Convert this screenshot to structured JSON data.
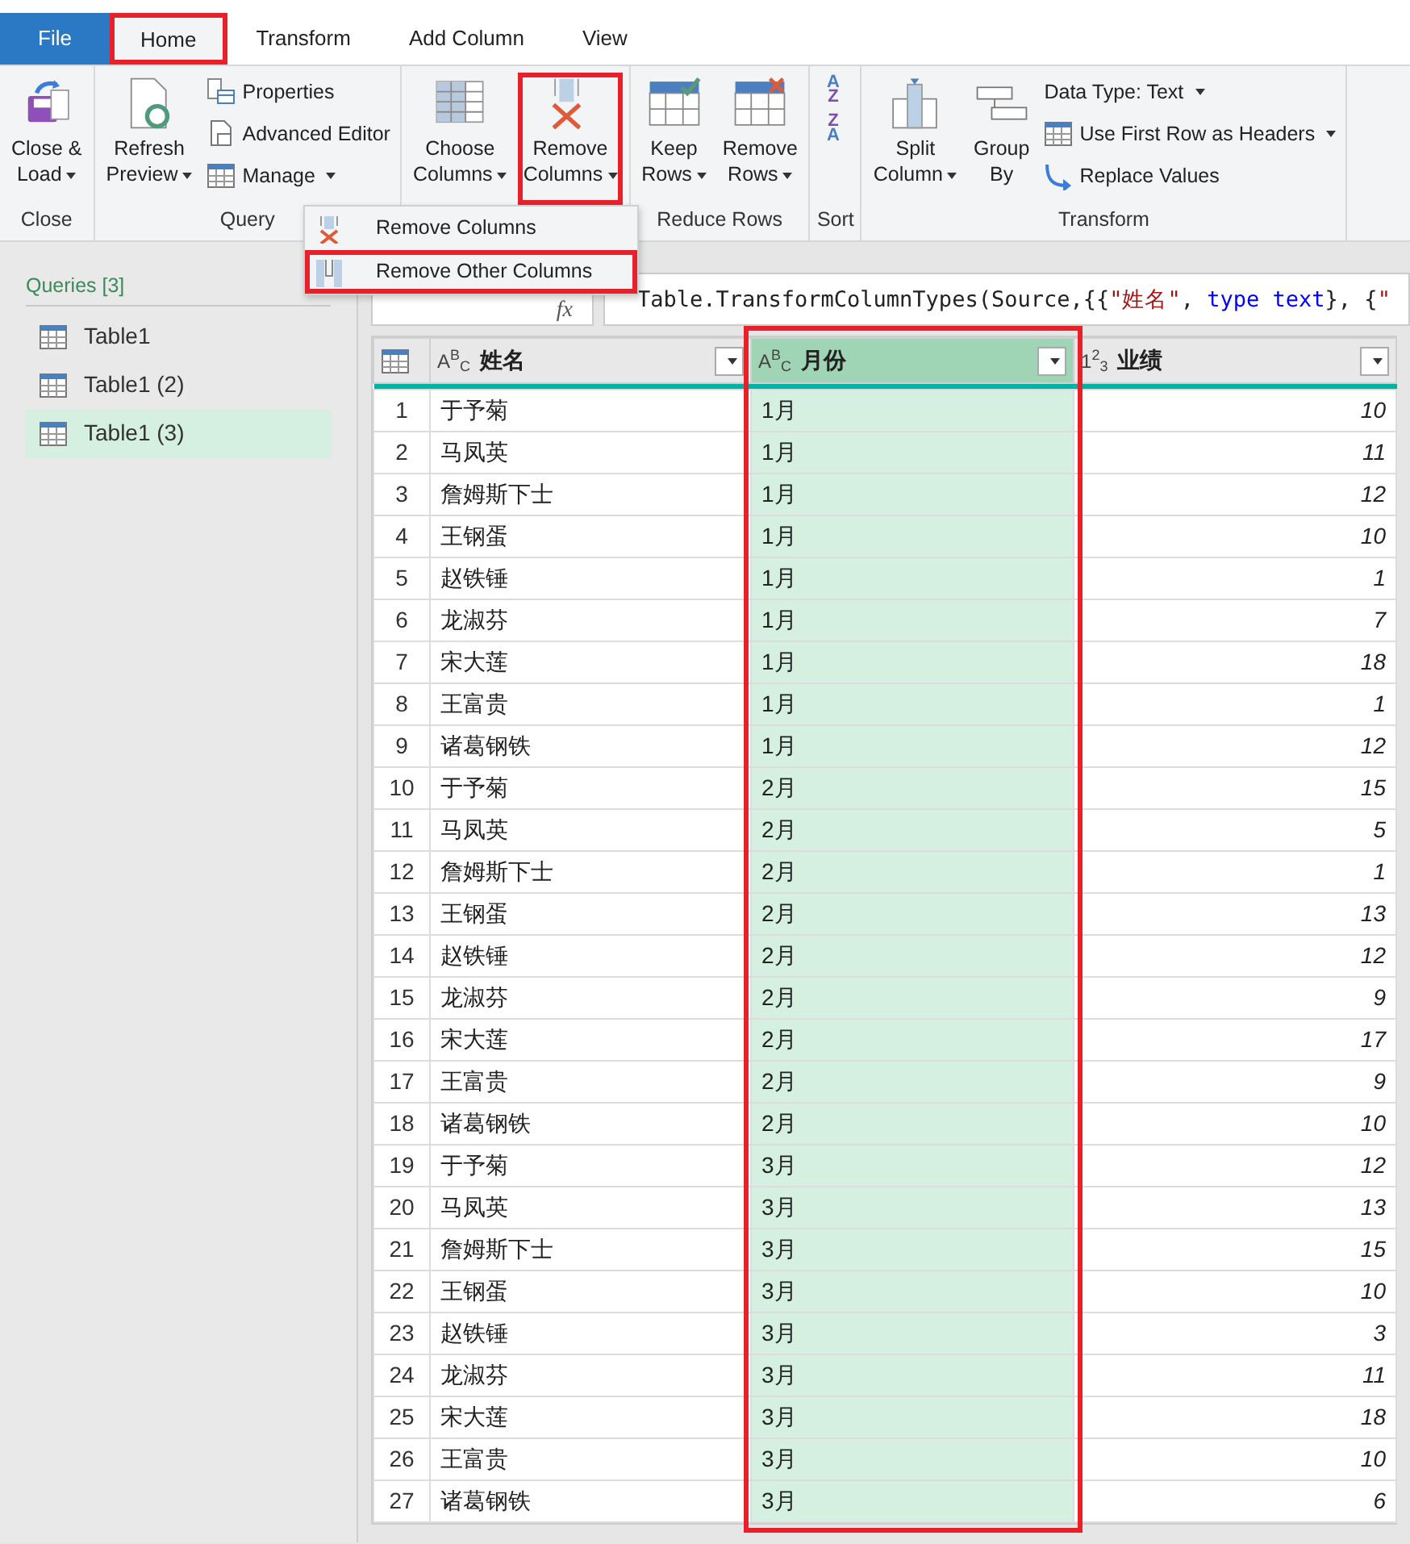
{
  "tabs": [
    {
      "label": "File",
      "kind": "file",
      "selected": false,
      "highlighted": false
    },
    {
      "label": "Home",
      "kind": "tab",
      "selected": true,
      "highlighted": true
    },
    {
      "label": "Transform",
      "kind": "tab",
      "selected": false,
      "highlighted": false
    },
    {
      "label": "Add Column",
      "kind": "tab",
      "selected": false,
      "highlighted": false
    },
    {
      "label": "View",
      "kind": "tab",
      "selected": false,
      "highlighted": false
    }
  ],
  "ribbon": {
    "groups": [
      {
        "label": "Close",
        "items": [
          {
            "kind": "large",
            "lines": [
              "Close &",
              "Load"
            ],
            "caret": true,
            "highlighted": false
          }
        ]
      },
      {
        "label": "Query",
        "items": [
          {
            "kind": "large",
            "lines": [
              "Refresh",
              "Preview"
            ],
            "caret": true,
            "highlighted": false
          },
          {
            "kind": "stack",
            "entries": [
              {
                "label": "Properties",
                "caret": false
              },
              {
                "label": "Advanced Editor",
                "caret": false
              },
              {
                "label": "Manage",
                "caret": true
              }
            ]
          }
        ]
      },
      {
        "items": [
          {
            "kind": "large",
            "lines": [
              "Choose",
              "Columns"
            ],
            "caret": true,
            "highlighted": false
          },
          {
            "kind": "large",
            "lines": [
              "Remove",
              "Columns"
            ],
            "caret": true,
            "highlighted": true
          }
        ]
      },
      {
        "label": "Reduce Rows",
        "items": [
          {
            "kind": "large",
            "lines": [
              "Keep",
              "Rows"
            ],
            "caret": true,
            "highlighted": false
          },
          {
            "kind": "large",
            "lines": [
              "Remove",
              "Rows"
            ],
            "caret": true,
            "highlighted": false
          }
        ]
      },
      {
        "label": "Sort",
        "items": [
          {
            "kind": "sort",
            "entries": [
              {
                "glyphs": [
                  "A",
                  "Z"
                ]
              },
              {
                "glyphs": [
                  "Z",
                  "A"
                ]
              }
            ]
          }
        ]
      },
      {
        "label": "Transform",
        "items": [
          {
            "kind": "large",
            "lines": [
              "Split",
              "Column"
            ],
            "caret": true,
            "highlighted": false
          },
          {
            "kind": "large",
            "lines": [
              "Group",
              "By"
            ],
            "caret": false,
            "highlighted": false
          },
          {
            "kind": "stack",
            "entries": [
              {
                "label": "Data Type: Text",
                "caret": true
              },
              {
                "label": "Use First Row as Headers",
                "caret": true
              },
              {
                "label": "Replace Values",
                "caret": false
              }
            ]
          }
        ]
      }
    ]
  },
  "menu": {
    "items": [
      {
        "label": "Remove Columns",
        "highlighted": false
      },
      {
        "label": "Remove Other Columns",
        "highlighted": true
      }
    ]
  },
  "queries": {
    "heading": "Queries [3]",
    "items": [
      {
        "label": "Table1",
        "selected": false
      },
      {
        "label": "Table1 (2)",
        "selected": false
      },
      {
        "label": "Table1 (3)",
        "selected": true
      }
    ]
  },
  "formula_bar": {
    "fx": "fx",
    "tokens": [
      {
        "text": "Table.TransformColumnTypes(Source,{{",
        "kind": "plain"
      },
      {
        "text": "\"姓名\"",
        "kind": "string"
      },
      {
        "text": ", ",
        "kind": "plain"
      },
      {
        "text": "type text",
        "kind": "keyword"
      },
      {
        "text": "}, {",
        "kind": "plain"
      },
      {
        "text": "\"",
        "kind": "string"
      }
    ]
  },
  "table": {
    "columns": [
      {
        "type": "A$^{B}$$_{C}$",
        "name": "姓名",
        "kind": "text",
        "selected": false,
        "highlighted": false
      },
      {
        "type": "A$^{B}$$_{C}$",
        "name": "月份",
        "kind": "text",
        "selected": true,
        "highlighted": true
      },
      {
        "type": "1$^{2}$$_{3}$",
        "name": "业绩",
        "kind": "number",
        "selected": false,
        "highlighted": false
      }
    ],
    "rows": [
      {
        "number": "1",
        "cells": [
          "于予菊",
          "1月",
          "10"
        ]
      },
      {
        "number": "2",
        "cells": [
          "马凤英",
          "1月",
          "11"
        ]
      },
      {
        "number": "3",
        "cells": [
          "詹姆斯下士",
          "1月",
          "12"
        ]
      },
      {
        "number": "4",
        "cells": [
          "王钢蛋",
          "1月",
          "10"
        ]
      },
      {
        "number": "5",
        "cells": [
          "赵铁锤",
          "1月",
          "1"
        ]
      },
      {
        "number": "6",
        "cells": [
          "龙淑芬",
          "1月",
          "7"
        ]
      },
      {
        "number": "7",
        "cells": [
          "宋大莲",
          "1月",
          "18"
        ]
      },
      {
        "number": "8",
        "cells": [
          "王富贵",
          "1月",
          "1"
        ]
      },
      {
        "number": "9",
        "cells": [
          "诸葛钢铁",
          "1月",
          "12"
        ]
      },
      {
        "number": "10",
        "cells": [
          "于予菊",
          "2月",
          "15"
        ]
      },
      {
        "number": "11",
        "cells": [
          "马凤英",
          "2月",
          "5"
        ]
      },
      {
        "number": "12",
        "cells": [
          "詹姆斯下士",
          "2月",
          "1"
        ]
      },
      {
        "number": "13",
        "cells": [
          "王钢蛋",
          "2月",
          "13"
        ]
      },
      {
        "number": "14",
        "cells": [
          "赵铁锤",
          "2月",
          "12"
        ]
      },
      {
        "number": "15",
        "cells": [
          "龙淑芬",
          "2月",
          "9"
        ]
      },
      {
        "number": "16",
        "cells": [
          "宋大莲",
          "2月",
          "17"
        ]
      },
      {
        "number": "17",
        "cells": [
          "王富贵",
          "2月",
          "9"
        ]
      },
      {
        "number": "18",
        "cells": [
          "诸葛钢铁",
          "2月",
          "10"
        ]
      },
      {
        "number": "19",
        "cells": [
          "于予菊",
          "3月",
          "12"
        ]
      },
      {
        "number": "20",
        "cells": [
          "马凤英",
          "3月",
          "13"
        ]
      },
      {
        "number": "21",
        "cells": [
          "詹姆斯下士",
          "3月",
          "15"
        ]
      },
      {
        "number": "22",
        "cells": [
          "王钢蛋",
          "3月",
          "10"
        ]
      },
      {
        "number": "23",
        "cells": [
          "赵铁锤",
          "3月",
          "3"
        ]
      },
      {
        "number": "24",
        "cells": [
          "龙淑芬",
          "3月",
          "11"
        ]
      },
      {
        "number": "25",
        "cells": [
          "宋大莲",
          "3月",
          "18"
        ]
      },
      {
        "number": "26",
        "cells": [
          "王富贵",
          "3月",
          "10"
        ]
      },
      {
        "number": "27",
        "cells": [
          "诸葛钢铁",
          "3月",
          "6"
        ]
      }
    ]
  }
}
